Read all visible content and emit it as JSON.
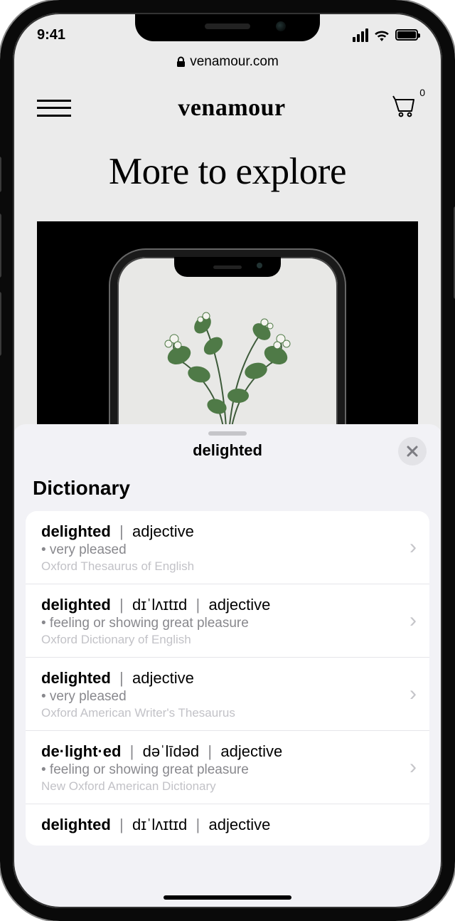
{
  "status": {
    "time": "9:41"
  },
  "browser": {
    "domain": "venamour.com"
  },
  "site": {
    "logo": "venamour",
    "hero": "More to explore",
    "cart_count": "0"
  },
  "sheet": {
    "title": "delighted",
    "section": "Dictionary",
    "entries": [
      {
        "word": "delighted",
        "pron": "",
        "pos": "adjective",
        "def": "• very pleased",
        "source": "Oxford Thesaurus of English"
      },
      {
        "word": "delighted",
        "pron": "dɪˈlʌɪtɪd",
        "pos": "adjective",
        "def": "• feeling or showing great pleasure",
        "source": "Oxford Dictionary of English"
      },
      {
        "word": "delighted",
        "pron": "",
        "pos": "adjective",
        "def": "• very pleased",
        "source": "Oxford American Writer's Thesaurus"
      },
      {
        "word": "de·light·ed",
        "pron": "dəˈlīdəd",
        "pos": "adjective",
        "def": "• feeling or showing great pleasure",
        "source": "New Oxford American Dictionary"
      },
      {
        "word": "delighted",
        "pron": "dɪˈlʌɪtɪd",
        "pos": "adjective",
        "def": "",
        "source": ""
      }
    ]
  }
}
